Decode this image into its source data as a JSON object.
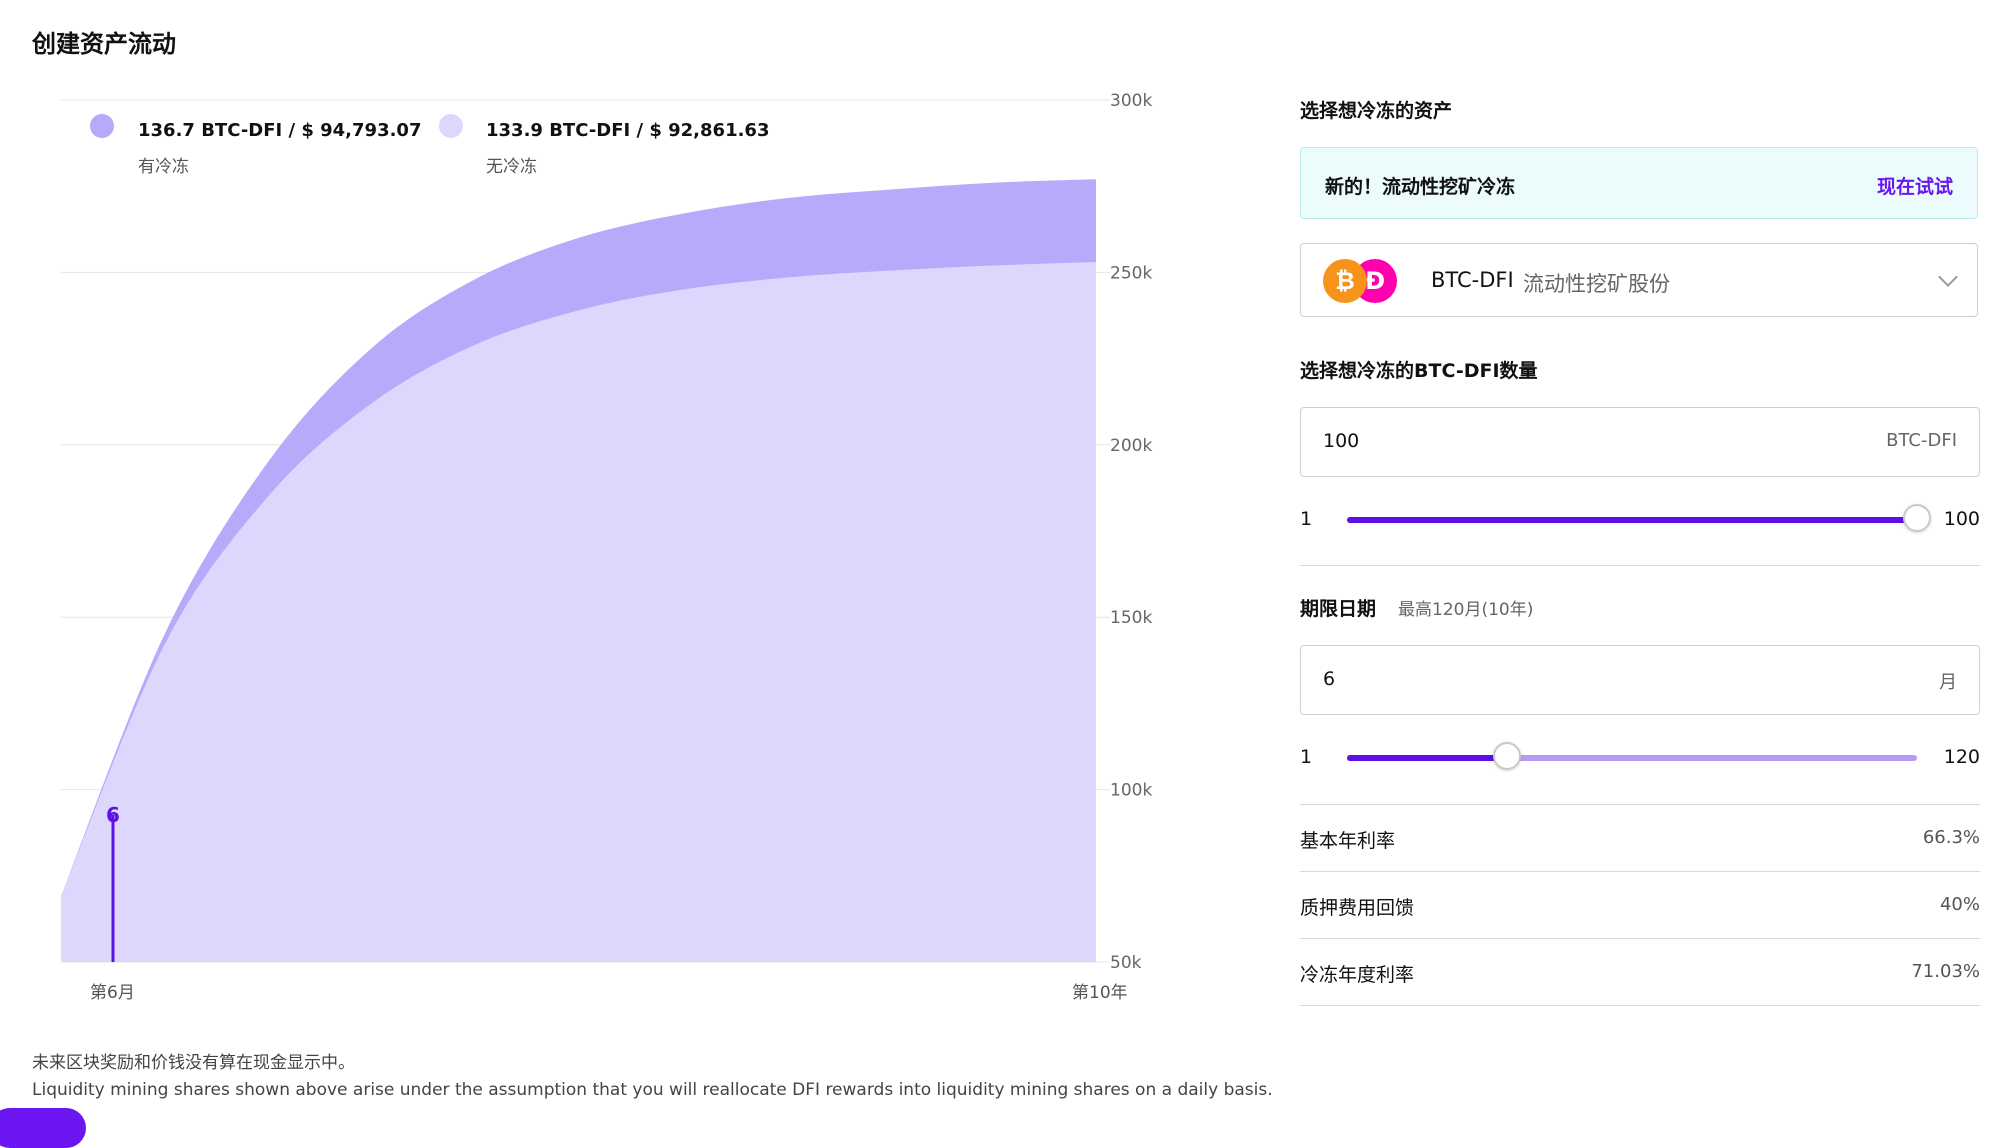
{
  "page": {
    "title": "创建资产流动"
  },
  "legend": {
    "frozen": {
      "amount": "136.7 BTC-DFI / $ 94,793.07",
      "label": "有冷冻",
      "color": "#b8a9fa"
    },
    "unfrozen": {
      "amount": "133.9 BTC-DFI / $ 92,861.63",
      "label": "无冷冻",
      "color": "#ddd6fd"
    }
  },
  "chart_data": {
    "type": "area",
    "x_axis_ticks": [
      "第6月",
      "第10年"
    ],
    "y_axis_ticks": [
      "300k",
      "250k",
      "200k",
      "150k",
      "100k",
      "50k"
    ],
    "ylim": [
      50000,
      300000
    ],
    "grid": true,
    "legend_position": "top-left",
    "marker": {
      "x_label": "第6月",
      "label": "6"
    },
    "series": [
      {
        "name": "有冷冻",
        "color": "#b8a9fa",
        "x": [
          0,
          0.1,
          0.2,
          0.3,
          0.4,
          0.5,
          0.6,
          0.7,
          0.8,
          0.9,
          1.0
        ],
        "values": [
          69000,
          145000,
          195000,
          228000,
          248000,
          260000,
          267000,
          271500,
          274000,
          276000,
          277000
        ]
      },
      {
        "name": "无冷冻",
        "color": "#ddd6fd",
        "x": [
          0,
          0.1,
          0.2,
          0.3,
          0.4,
          0.5,
          0.6,
          0.7,
          0.8,
          0.9,
          1.0
        ],
        "values": [
          69000,
          142000,
          185000,
          212000,
          229000,
          239000,
          245000,
          248500,
          250500,
          252000,
          253000
        ]
      }
    ]
  },
  "footnotes": {
    "line1": "未来区块奖励和价钱没有算在现金显示中。",
    "line2": "Liquidity mining shares shown above arise under the assumption that you will reallocate DFI rewards into liquidity mining shares on a daily basis."
  },
  "panel": {
    "asset_label": "选择想冷冻的资产",
    "promo": {
      "text": "新的！流动性挖矿冷冻",
      "link": "现在试试"
    },
    "asset_select": {
      "btc_symbol": "₿",
      "dfi_symbol": "Ð",
      "pair": "BTC-DFI",
      "desc": "流动性挖矿股份"
    },
    "amount_label": "选择想冷冻的BTC-DFI数量",
    "amount": {
      "value": "100",
      "unit": "BTC-DFI",
      "min": "1",
      "max": "100",
      "slider_fraction": 1.0
    },
    "term_label": "期限日期",
    "term_hint": "最高120月(10年)",
    "term": {
      "value": "6",
      "unit": "月",
      "min": "1",
      "max": "120",
      "slider_fraction": 0.28
    },
    "stats": [
      {
        "label": "基本年利率",
        "value": "66.3%"
      },
      {
        "label": "质押费用回馈",
        "value": "40%"
      },
      {
        "label": "冷冻年度利率",
        "value": "71.03%"
      }
    ]
  },
  "colors": {
    "accent": "#6b16f0",
    "slider_track": "#b99af5",
    "promo_bg": "#ecfcfd"
  }
}
